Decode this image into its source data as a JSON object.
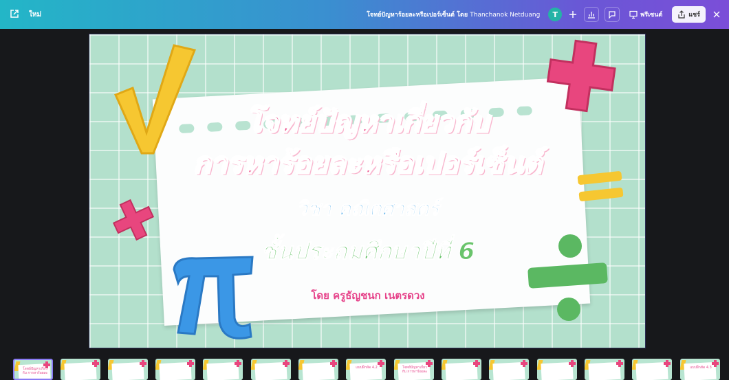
{
  "topbar": {
    "new_label": "ใหม่",
    "title": "โจทย์ปัญหาร้อยละหรือเปอร์เซ็นต์",
    "by": "โดย",
    "author": "Thanchanok Netduang",
    "avatar_initial": "T",
    "present_label": "พรีเซนต์",
    "share_label": "แชร์"
  },
  "slide": {
    "title_line1": "โจทย์ปัญหาเกี่ยวกับ",
    "title_line2": "การหาร้อยละหรือเปอร์เซ็นต์",
    "subject": "วิชา คณิตศาสตร์",
    "grade": "ชั้นประถมศึกษาปีที่ 6",
    "teacher": "โดย ครูธัญชนก เนตรดวง"
  },
  "colors": {
    "accent_pink": "#ec4f8b",
    "accent_blue": "#4ba9e8",
    "accent_green": "#6ac46c",
    "accent_yellow": "#f6c731",
    "slide_bg": "#b3e0cc"
  },
  "thumbnails": [
    {
      "label": "โจทย์ปัญหาเกี่ยวกับ การหาร้อยละ"
    },
    {
      "label": ""
    },
    {
      "label": ""
    },
    {
      "label": ""
    },
    {
      "label": ""
    },
    {
      "label": ""
    },
    {
      "label": ""
    },
    {
      "label": "แบบฝึกหัด 4.2"
    },
    {
      "label": "โจทย์ปัญหาเกี่ยวกับ การหาร้อยละ"
    },
    {
      "label": ""
    },
    {
      "label": ""
    },
    {
      "label": ""
    },
    {
      "label": ""
    },
    {
      "label": ""
    },
    {
      "label": "แบบฝึกหัด 4.3"
    }
  ]
}
